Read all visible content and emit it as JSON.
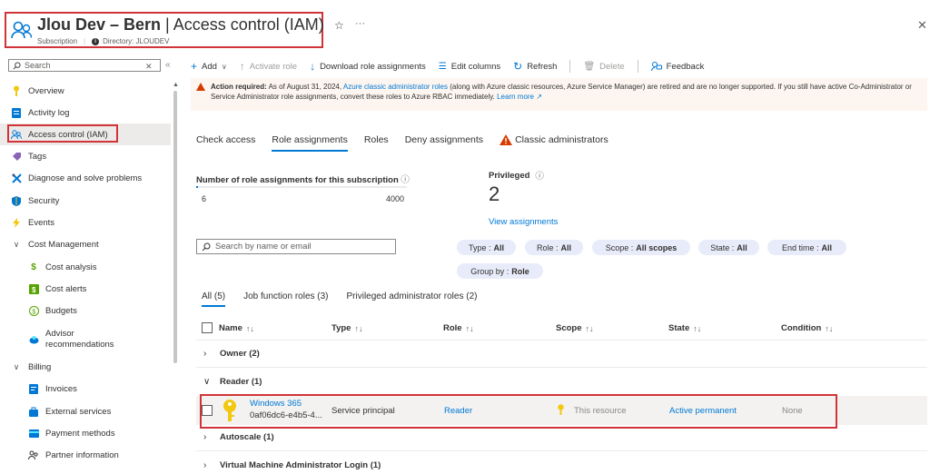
{
  "header": {
    "title_bold": "Jlou Dev – Bern",
    "title_rest": "Access control (IAM)",
    "subtitle_type": "Subscription",
    "directory_label": "Directory: JLOUDEV"
  },
  "sidebar": {
    "search_placeholder": "Search",
    "items": [
      {
        "label": "Overview",
        "icon": "key-icon"
      },
      {
        "label": "Activity log",
        "icon": "log-icon"
      },
      {
        "label": "Access control (IAM)",
        "icon": "people-icon"
      },
      {
        "label": "Tags",
        "icon": "tag-icon"
      },
      {
        "label": "Diagnose and solve problems",
        "icon": "wrench-icon"
      },
      {
        "label": "Security",
        "icon": "shield-icon"
      },
      {
        "label": "Events",
        "icon": "lightning-icon"
      },
      {
        "label": "Cost Management",
        "icon": "chevron-down-icon"
      },
      {
        "label": "Cost analysis",
        "icon": "cost-icon"
      },
      {
        "label": "Cost alerts",
        "icon": "alert-icon"
      },
      {
        "label": "Budgets",
        "icon": "budget-icon"
      },
      {
        "label": "Advisor",
        "label2": "recommendations",
        "icon": "advisor-icon"
      },
      {
        "label": "Billing",
        "icon": "chevron-down-icon"
      },
      {
        "label": "Invoices",
        "icon": "invoice-icon"
      },
      {
        "label": "External services",
        "icon": "bag-icon"
      },
      {
        "label": "Payment methods",
        "icon": "card-icon"
      },
      {
        "label": "Partner information",
        "icon": "partner-icon"
      }
    ]
  },
  "toolbar": {
    "add": "Add",
    "activate_role": "Activate role",
    "download": "Download role assignments",
    "edit_columns": "Edit columns",
    "refresh": "Refresh",
    "delete": "Delete",
    "feedback": "Feedback"
  },
  "banner": {
    "bold": "Action required:",
    "text1": " As of August 31, 2024, ",
    "link1": "Azure classic administrator roles",
    "text2": " (along with Azure classic resources, Azure Service Manager) are retired and are no longer supported. If you still have active Co-Administrator or Service Administrator role assignments, convert these roles to Azure RBAC immediately. ",
    "link2": "Learn more ↗"
  },
  "tabs": [
    "Check access",
    "Role assignments",
    "Roles",
    "Deny assignments",
    "Classic administrators"
  ],
  "stats": {
    "count_label": "Number of role assignments for this subscription",
    "count_current": "6",
    "count_max": "4000",
    "count_fraction": 0.0015,
    "privileged_label": "Privileged",
    "privileged_value": "2",
    "view_link": "View assignments"
  },
  "filters": {
    "search_placeholder": "Search by name or email",
    "pills": [
      {
        "label": "Type :",
        "value": "All"
      },
      {
        "label": "Role :",
        "value": "All"
      },
      {
        "label": "Scope :",
        "value": "All scopes"
      },
      {
        "label": "State :",
        "value": "All"
      },
      {
        "label": "End time :",
        "value": "All"
      },
      {
        "label": "Group by :",
        "value": "Role"
      }
    ]
  },
  "subtabs": [
    "All (5)",
    "Job function roles (3)",
    "Privileged administrator roles (2)"
  ],
  "table": {
    "columns": [
      "Name",
      "Type",
      "Role",
      "Scope",
      "State",
      "Condition"
    ],
    "sort_glyph": "↑↓",
    "groups": [
      "Owner (2)",
      "Reader (1)",
      "Autoscale (1)",
      "Virtual Machine Administrator Login (1)"
    ],
    "row": {
      "name": "Windows 365",
      "id": "0af06dc6-e4b5-4...",
      "type": "Service principal",
      "role": "Reader",
      "scope": "This resource",
      "state": "Active permanent",
      "condition": "None"
    }
  },
  "colors": {
    "accent": "#0078d4",
    "highlight_border": "#d13438",
    "warning": "#d83b01"
  }
}
